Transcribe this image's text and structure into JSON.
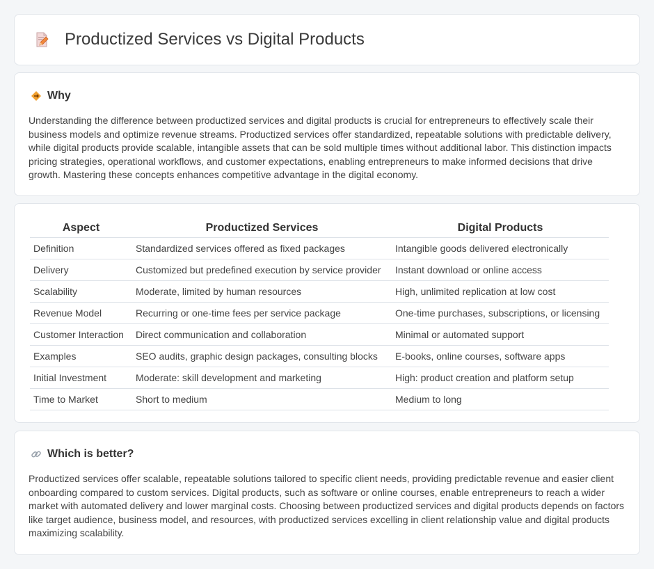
{
  "header": {
    "title": "Productized Services vs Digital Products",
    "icon": "document-pencil-icon"
  },
  "why": {
    "icon": "diamond-sign-icon",
    "title": "Why",
    "text": "Understanding the difference between productized services and digital products is crucial for entrepreneurs to effectively scale their business models and optimize revenue streams. Productized services offer standardized, repeatable solutions with predictable delivery, while digital products provide scalable, intangible assets that can be sold multiple times without additional labor. This distinction impacts pricing strategies, operational workflows, and customer expectations, enabling entrepreneurs to make informed decisions that drive growth. Mastering these concepts enhances competitive advantage in the digital economy."
  },
  "comparison": {
    "headers": [
      "Aspect",
      "Productized Services",
      "Digital Products"
    ],
    "rows": [
      [
        "Definition",
        "Standardized services offered as fixed packages",
        "Intangible goods delivered electronically"
      ],
      [
        "Delivery",
        "Customized but predefined execution by service provider",
        "Instant download or online access"
      ],
      [
        "Scalability",
        "Moderate, limited by human resources",
        "High, unlimited replication at low cost"
      ],
      [
        "Revenue Model",
        "Recurring or one-time fees per service package",
        "One-time purchases, subscriptions, or licensing"
      ],
      [
        "Customer Interaction",
        "Direct communication and collaboration",
        "Minimal or automated support"
      ],
      [
        "Examples",
        "SEO audits, graphic design packages, consulting blocks",
        "E-books, online courses, software apps"
      ],
      [
        "Initial Investment",
        "Moderate: skill development and marketing",
        "High: product creation and platform setup"
      ],
      [
        "Time to Market",
        "Short to medium",
        "Medium to long"
      ]
    ]
  },
  "better": {
    "icon": "link-icon",
    "title": "Which is better?",
    "text": "Productized services offer scalable, repeatable solutions tailored to specific client needs, providing predictable revenue and easier client onboarding compared to custom services. Digital products, such as software or online courses, enable entrepreneurs to reach a wider market with automated delivery and lower marginal costs. Choosing between productized services and digital products depends on factors like target audience, business model, and resources, with productized services excelling in client relationship value and digital products maximizing scalability."
  },
  "colors": {
    "page_bg": "#f4f6f8",
    "card_bg": "#ffffff",
    "border": "#e1e5ea",
    "icon_accent": "#f0a030"
  }
}
